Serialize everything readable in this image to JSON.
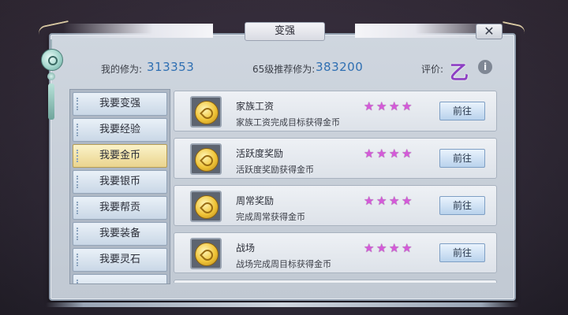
{
  "window": {
    "title": "变强",
    "close_label": "✕"
  },
  "stats": {
    "my_cultivation_label": "我的修为:",
    "my_cultivation_value": "313353",
    "recommended_label": "65级推荐修为:",
    "recommended_value": "383200",
    "rating_label": "评价:",
    "rating_value": "乙",
    "info_label": "i"
  },
  "menu": {
    "items": [
      {
        "label": "我要变强"
      },
      {
        "label": "我要经验"
      },
      {
        "label": "我要金币"
      },
      {
        "label": "我要银币"
      },
      {
        "label": "我要帮贡"
      },
      {
        "label": "我要装备"
      },
      {
        "label": "我要灵石"
      }
    ],
    "active_index": 2
  },
  "list": {
    "rows": [
      {
        "title": "家族工资",
        "desc": "家族工资完成目标获得金币",
        "stars": 4,
        "button": "前往",
        "icon": "gold-coin-icon"
      },
      {
        "title": "活跃度奖励",
        "desc": "活跃度奖励获得金币",
        "stars": 4,
        "button": "前往",
        "icon": "gold-coin-icon"
      },
      {
        "title": "周常奖励",
        "desc": "完成周常获得金币",
        "stars": 4,
        "button": "前往",
        "icon": "gold-coin-icon"
      },
      {
        "title": "战场",
        "desc": "战场完成周目标获得金币",
        "stars": 4,
        "button": "前往",
        "icon": "gold-coin-icon"
      }
    ]
  },
  "colors": {
    "value_blue": "#2f6fb2",
    "star_purple": "#d55ad9",
    "grade_purple": "#8d3fc3",
    "active_menu_gold": "#ead48e"
  }
}
